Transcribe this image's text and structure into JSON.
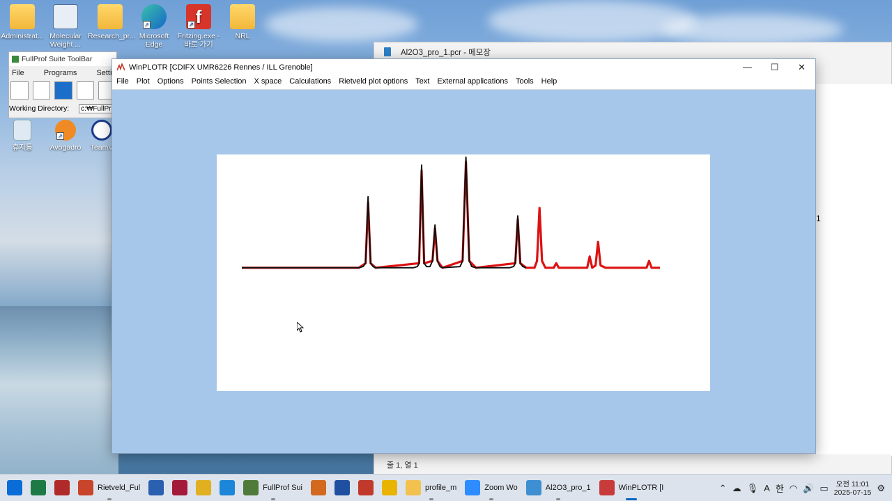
{
  "desktop": {
    "icons": [
      {
        "label": "Administrat...",
        "icon": "user-folder-icon"
      },
      {
        "label": "Molecular Weight ...",
        "icon": "calculator-icon"
      },
      {
        "label": "Research_pr...",
        "icon": "folder-icon"
      },
      {
        "label": "Microsoft Edge",
        "icon": "edge-icon"
      },
      {
        "label": "Fritzing.exe - 바로 가기",
        "icon": "fritzing-icon"
      },
      {
        "label": "NRL",
        "icon": "folder-icon"
      },
      {
        "label": "휴지통",
        "icon": "recycle-bin-icon"
      },
      {
        "label": "Avogadro",
        "icon": "avogadro-icon"
      },
      {
        "label": "TeamV",
        "icon": "teamviewer-icon"
      }
    ]
  },
  "notepad": {
    "title": "Al2O3_pro_1.pcr - 메모장",
    "status": "줄 1, 열 1",
    "side_text": "1"
  },
  "fullprof_toolbar": {
    "title": "FullProf Suite ToolBar",
    "menu": [
      "File",
      "Programs",
      "Settings"
    ],
    "working_dir_label": "Working Directory:",
    "working_dir_value": "c:₩FullPr"
  },
  "winplotr": {
    "title": "WinPLOTR [CDIFX UMR6226 Rennes / ILL Grenoble]",
    "menu": [
      "File",
      "Plot",
      "Options",
      "Points Selection",
      "X space",
      "Calculations",
      "Rietveld plot options",
      "Text",
      "External applications",
      "Tools",
      "Help"
    ],
    "controls": {
      "minimize": "—",
      "maximize": "☐",
      "close": "✕"
    }
  },
  "chart_data": {
    "type": "line",
    "title": "",
    "xlabel": "",
    "ylabel": "",
    "xlim": [
      0,
      100
    ],
    "ylim": [
      0,
      100
    ],
    "grid": false,
    "series": [
      {
        "color": "#111111",
        "points": [
          [
            0,
            2
          ],
          [
            28,
            2
          ],
          [
            29,
            3
          ],
          [
            29.6,
            6
          ],
          [
            30.2,
            65
          ],
          [
            30.8,
            6
          ],
          [
            31.4,
            3
          ],
          [
            32,
            2
          ],
          [
            41,
            2
          ],
          [
            42,
            3
          ],
          [
            42.4,
            6
          ],
          [
            43,
            93
          ],
          [
            43.6,
            6
          ],
          [
            44.2,
            3
          ],
          [
            45,
            3
          ],
          [
            45.6,
            8
          ],
          [
            46.2,
            40
          ],
          [
            46.8,
            8
          ],
          [
            47.4,
            3
          ],
          [
            48,
            2
          ],
          [
            52.2,
            3
          ],
          [
            52.8,
            8
          ],
          [
            53.6,
            100
          ],
          [
            54.4,
            8
          ],
          [
            55,
            3
          ],
          [
            56,
            2
          ],
          [
            64,
            2
          ],
          [
            65,
            3
          ],
          [
            65.4,
            6
          ],
          [
            66,
            48
          ],
          [
            66.6,
            6
          ],
          [
            67.2,
            3
          ],
          [
            68,
            2
          ]
        ]
      },
      {
        "color": "#dd1111",
        "points": [
          [
            0,
            2
          ],
          [
            28,
            2
          ],
          [
            29.6,
            6
          ],
          [
            30.2,
            60
          ],
          [
            30.8,
            6
          ],
          [
            32,
            2
          ],
          [
            42.4,
            6
          ],
          [
            43,
            88
          ],
          [
            43.6,
            6
          ],
          [
            45.6,
            8
          ],
          [
            46.2,
            37
          ],
          [
            46.8,
            8
          ],
          [
            48,
            2
          ],
          [
            52.8,
            8
          ],
          [
            53.6,
            96
          ],
          [
            54.4,
            8
          ],
          [
            56,
            2
          ],
          [
            65.4,
            6
          ],
          [
            66,
            45
          ],
          [
            66.6,
            6
          ],
          [
            68,
            2
          ],
          [
            70,
            2
          ],
          [
            70.6,
            8
          ],
          [
            71.2,
            55
          ],
          [
            71.8,
            8
          ],
          [
            72.6,
            2
          ],
          [
            74.6,
            2
          ],
          [
            75.2,
            6
          ],
          [
            75.8,
            2
          ],
          [
            82.6,
            2
          ],
          [
            83.2,
            12
          ],
          [
            83.8,
            2
          ],
          [
            84.6,
            4
          ],
          [
            85.2,
            25
          ],
          [
            85.8,
            4
          ],
          [
            87,
            2
          ],
          [
            96.8,
            2
          ],
          [
            97.4,
            8
          ],
          [
            98,
            2
          ],
          [
            100,
            2
          ]
        ]
      }
    ]
  },
  "taskbar": {
    "items": [
      {
        "label": "",
        "icon": "windows-start-icon",
        "color": "#0a6cd6"
      },
      {
        "label": "",
        "icon": "excel-icon",
        "color": "#1d7a45"
      },
      {
        "label": "",
        "icon": "zotero-icon",
        "color": "#b02a2a"
      },
      {
        "label": "Rietveld_Ful",
        "icon": "powerpoint-icon",
        "color": "#c8442a"
      },
      {
        "label": "",
        "icon": "word-icon",
        "color": "#2b5fb0"
      },
      {
        "label": "",
        "icon": "mendeley-icon",
        "color": "#a31a3b"
      },
      {
        "label": "",
        "icon": "diamond-app-icon",
        "color": "#e0b020"
      },
      {
        "label": "",
        "icon": "edge-taskbar-icon",
        "color": "#1c86d8"
      },
      {
        "label": "FullProf Sui",
        "icon": "fullprof-icon",
        "color": "#4f7b3a"
      },
      {
        "label": "",
        "icon": "orange-app-icon",
        "color": "#d2691e"
      },
      {
        "label": "",
        "icon": "l-app-icon",
        "color": "#1f4fa0"
      },
      {
        "label": "",
        "icon": "snipping-icon",
        "color": "#c0392b"
      },
      {
        "label": "",
        "icon": "chrome-icon",
        "color": "#e8b400"
      },
      {
        "label": "profile_m",
        "icon": "explorer-folder-icon",
        "color": "#f2c14e"
      },
      {
        "label": "Zoom Wo",
        "icon": "zoom-icon",
        "color": "#2d8cff"
      },
      {
        "label": "Al2O3_pro_1",
        "icon": "notepad-icon",
        "color": "#3d8fd1"
      },
      {
        "label": "WinPLOTR [I",
        "icon": "winplotr-icon",
        "color": "#c83b3b"
      }
    ],
    "tray": {
      "ime_a": "A",
      "ime_han": "한",
      "time": "오전 11:01",
      "date": "2025-07-15"
    }
  }
}
